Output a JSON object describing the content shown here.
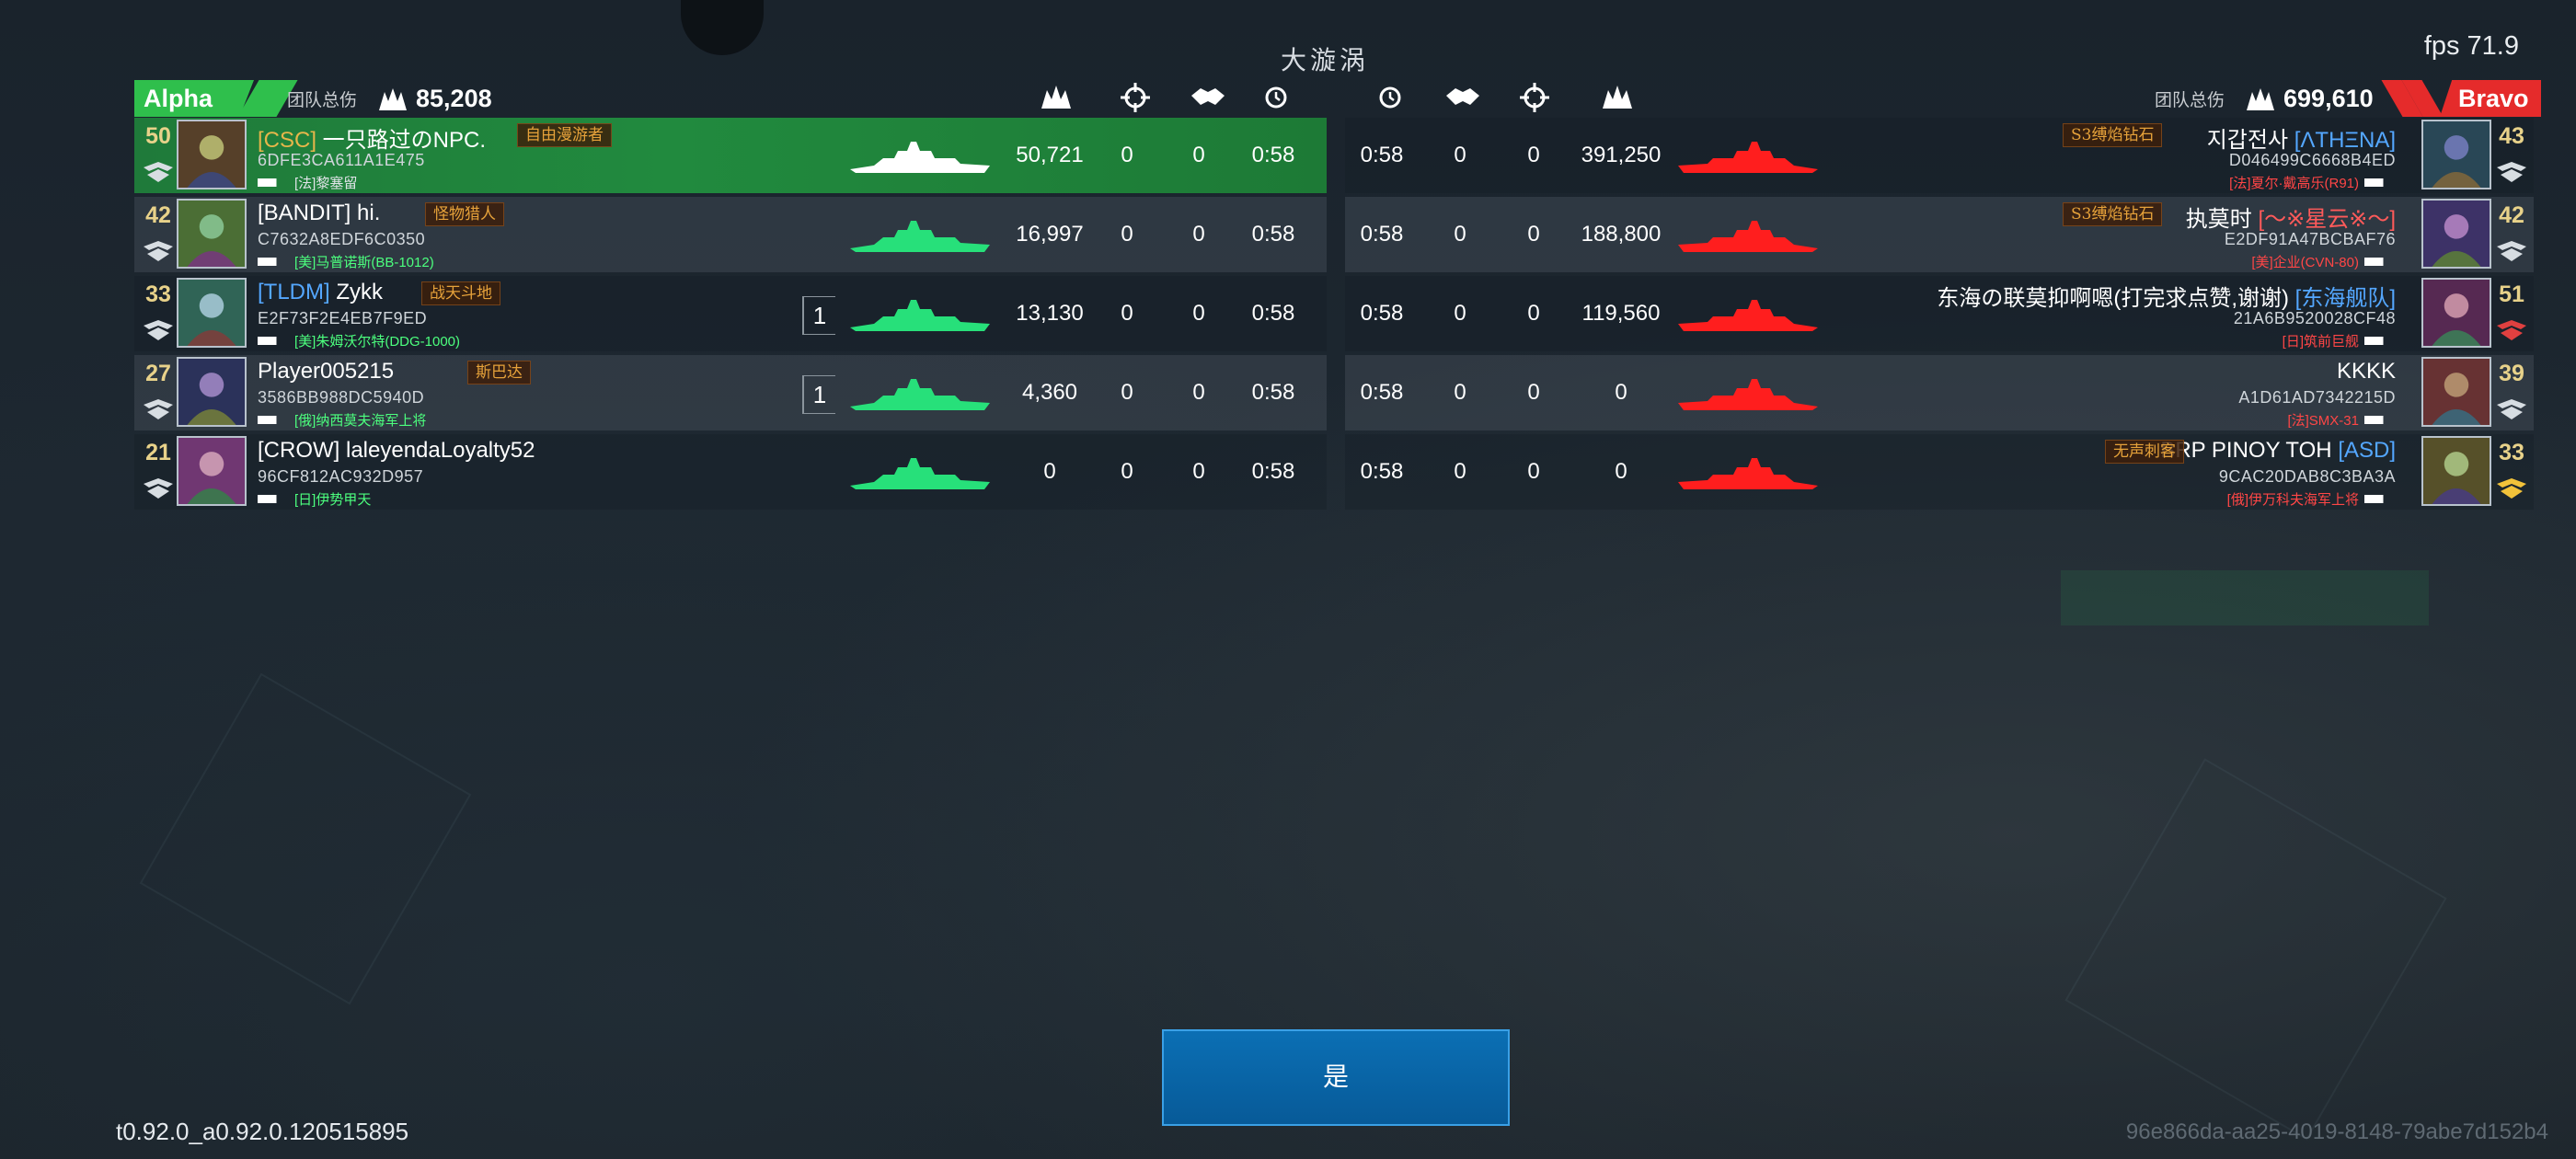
{
  "header": {
    "map_name": "大漩涡",
    "fps": "fps 71.9"
  },
  "teams": {
    "alpha": {
      "name": "Alpha",
      "score_label": "团队总伤",
      "score": "85,208",
      "color": "#2fbf4c"
    },
    "bravo": {
      "name": "Bravo",
      "score_label": "团队总伤",
      "score": "699,610",
      "color": "#e52b2b"
    }
  },
  "columns": {
    "left": [
      "damage-icon",
      "crosshair-icon",
      "handshake-icon",
      "clock-icon"
    ],
    "right": [
      "clock-icon",
      "handshake-icon",
      "crosshair-icon",
      "damage-icon"
    ]
  },
  "alpha_players": [
    {
      "level": "50",
      "tag": "[CSC]",
      "name": " 一只路过のNPC.",
      "title": "自由漫游者",
      "id": "6DFE3CA611A1E475",
      "ship": "[法]黎塞留",
      "kills": "",
      "damage": "50,721",
      "assists1": "0",
      "assists2": "0",
      "time": "0:58",
      "highlight": true
    },
    {
      "level": "42",
      "tag": "[BANDIT]",
      "name": " hi.",
      "title": "怪物猎人",
      "id": "C7632A8EDF6C0350",
      "ship": "[美]马普诺斯(BB-1012)",
      "kills": "",
      "damage": "16,997",
      "assists1": "0",
      "assists2": "0",
      "time": "0:58",
      "highlight": false
    },
    {
      "level": "33",
      "tag": "[TLDM]",
      "name": " Zykk",
      "title": "战天斗地",
      "id": "E2F73F2E4EB7F9ED",
      "ship": "[美]朱姆沃尔特(DDG-1000)",
      "kills": "1",
      "damage": "13,130",
      "assists1": "0",
      "assists2": "0",
      "time": "0:58",
      "highlight": false
    },
    {
      "level": "27",
      "tag": "",
      "name": "Player005215",
      "title": "斯巴达",
      "id": "3586BB988DC5940D",
      "ship": "[俄]纳西莫夫海军上将",
      "kills": "1",
      "damage": "4,360",
      "assists1": "0",
      "assists2": "0",
      "time": "0:58",
      "highlight": false
    },
    {
      "level": "21",
      "tag": "[CROW]",
      "name": " laleyendaLoyalty52",
      "title": "",
      "id": "96CF812AC932D957",
      "ship": "[日]伊势甲天",
      "kills": "",
      "damage": "0",
      "assists1": "0",
      "assists2": "0",
      "time": "0:58",
      "highlight": false
    }
  ],
  "bravo_players": [
    {
      "level": "43",
      "name": "지갑전사 ",
      "tag": "[ΛTHΞNA]",
      "title": "S3缚焰钻石",
      "id": "D046499C6668B4ED",
      "ship": "[法]夏尔·戴高乐(R91)",
      "kills": "",
      "damage": "391,250",
      "assists1": "0",
      "assists2": "0",
      "time": "0:58"
    },
    {
      "level": "42",
      "name": "执莫时 ",
      "tag": "[〜※星云※〜]",
      "title": "S3缚焰钻石",
      "id": "E2DF91A47BCBAF76",
      "ship": "[美]企业(CVN-80)",
      "kills": "",
      "damage": "188,800",
      "assists1": "0",
      "assists2": "0",
      "time": "0:58"
    },
    {
      "level": "51",
      "name": "东海の联莫抑啊嗯(打完求点赞,谢谢) ",
      "tag": "[东海舰队]",
      "title": "",
      "id": "21A6B9520028CF48",
      "ship": "[日]筑前巨舰",
      "kills": "",
      "damage": "119,560",
      "assists1": "0",
      "assists2": "0",
      "time": "0:58"
    },
    {
      "level": "39",
      "name": "KKKK",
      "tag": "",
      "title": "",
      "id": "A1D61AD7342215D",
      "ship": "[法]SMX-31",
      "kills": "",
      "damage": "0",
      "assists1": "0",
      "assists2": "0",
      "time": "0:58"
    },
    {
      "level": "33",
      "name": "BRP PINOY TOH ",
      "tag": "[ASD]",
      "title": "无声刺客",
      "id": "9CAC20DAB8C3BA3A",
      "ship": "[俄]伊万科夫海军上将",
      "kills": "",
      "damage": "0",
      "assists1": "0",
      "assists2": "0",
      "time": "0:58"
    }
  ],
  "footer": {
    "confirm_label": "是",
    "version": "t0.92.0_a0.92.0.120515895",
    "session_id": "96e866da-aa25-4019-8148-79abe7d152b4"
  }
}
